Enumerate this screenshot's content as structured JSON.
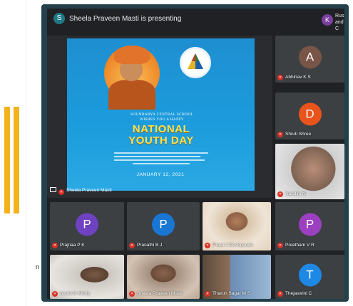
{
  "meeting": {
    "presenting_banner": "Sheela Praveen Masti is presenting",
    "presenter_initial": "S",
    "corner_initial": "K",
    "corner_label": "Rushe and C"
  },
  "presentation": {
    "presenter_label": "Sheela Praveen Masti",
    "poster": {
      "school_line1": "SOUNDARYA CENTRAL SCHOOL",
      "school_line2": "WISHES YOU A HAPPY",
      "title_line1": "NATIONAL",
      "title_line2": "YOUTH DAY",
      "date": "JANUARY 12, 2021"
    }
  },
  "participants": [
    {
      "name": "Abhinav K S",
      "initial": "A",
      "color": "#795548"
    },
    {
      "name": "Shruti Shree",
      "initial": "D",
      "color": "#e8541c"
    },
    {
      "name": "Nandini N",
      "initial": "",
      "color": "#6d5a4a"
    },
    {
      "name": "Prajnaa P K",
      "initial": "P",
      "color": "#6f42c1"
    },
    {
      "name": "Pranathi B J",
      "initial": "P",
      "color": "#1976d2"
    },
    {
      "name": "Prasit J Deshpande",
      "initial": "",
      "color": "#8a6f5a"
    },
    {
      "name": "Preetham V R",
      "initial": "P",
      "color": "#9c3fc0"
    },
    {
      "name": "Santosh Murty",
      "initial": "",
      "color": "#7a6a5a"
    },
    {
      "name": "Sheela Praveen Masti",
      "initial": "",
      "color": "#8c7b6a"
    },
    {
      "name": "Tharun Sagar M S",
      "initial": "",
      "color": "#6b5b4b"
    },
    {
      "name": "Thejaswini C",
      "initial": "T",
      "color": "#1e88e5"
    }
  ],
  "page_margin_letter": "n"
}
